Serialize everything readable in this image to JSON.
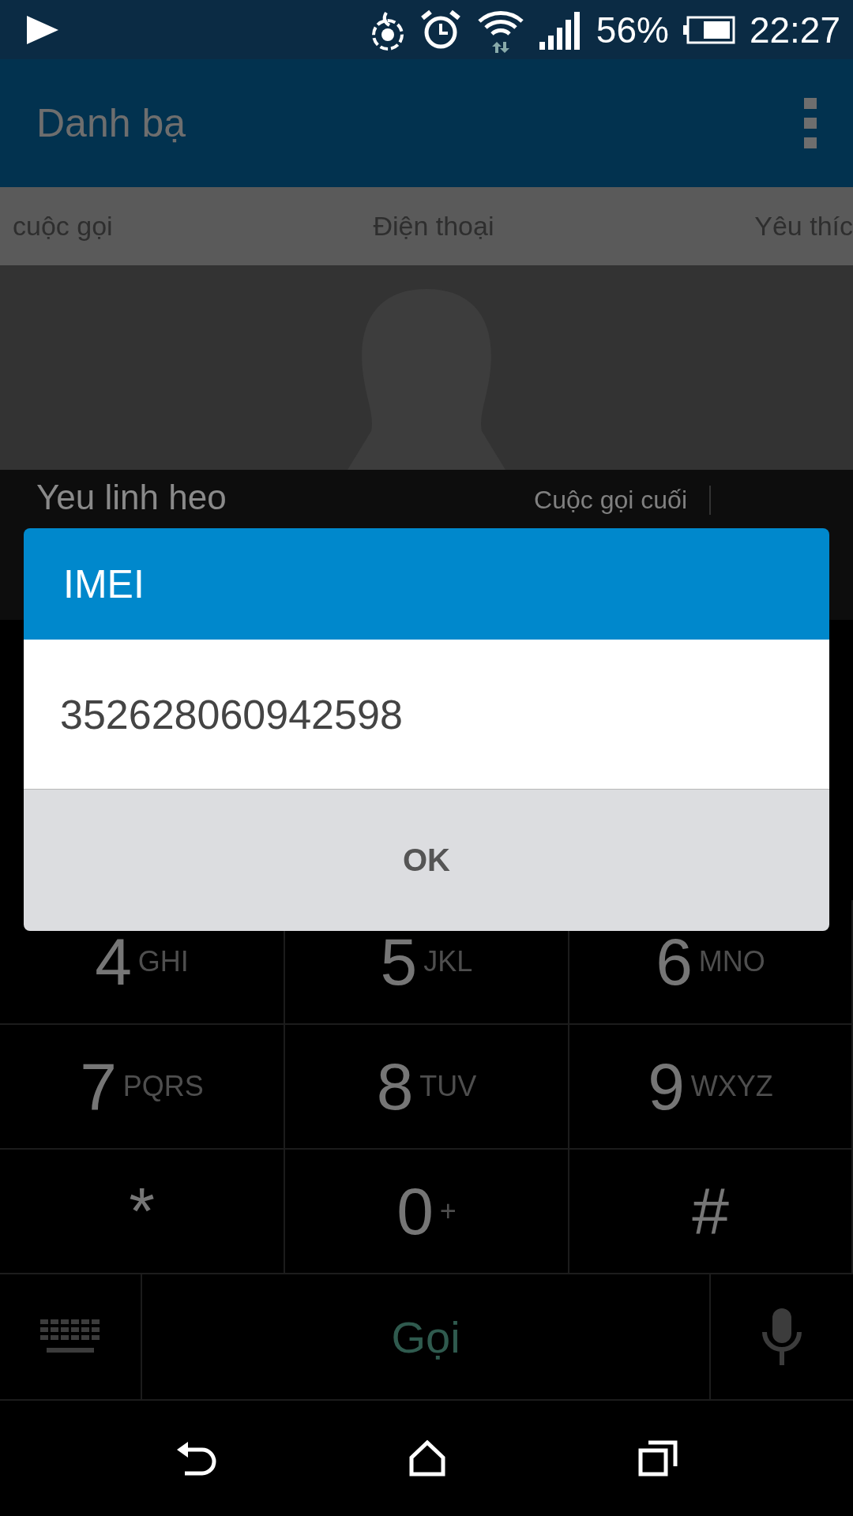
{
  "status_bar": {
    "battery": "56%",
    "time": "22:27"
  },
  "app_bar": {
    "title": "Danh bạ"
  },
  "tabs": [
    {
      "label": "cuộc gọi"
    },
    {
      "label": "Điện thoại"
    },
    {
      "label": "Yêu thíc"
    }
  ],
  "contact": {
    "name": "Yeu linh heo",
    "last_call_label": "Cuộc gọi cuối"
  },
  "dialog": {
    "title": "IMEI",
    "message": "352628060942598",
    "button": "OK"
  },
  "keypad": [
    {
      "digit": "4",
      "letters": "GHI"
    },
    {
      "digit": "5",
      "letters": "JKL"
    },
    {
      "digit": "6",
      "letters": "MNO"
    },
    {
      "digit": "7",
      "letters": "PQRS"
    },
    {
      "digit": "8",
      "letters": "TUV"
    },
    {
      "digit": "9",
      "letters": "WXYZ"
    },
    {
      "digit": "*"
    },
    {
      "digit": "0",
      "letters": "+"
    },
    {
      "digit": "#"
    }
  ],
  "call_bar": {
    "call_label": "Gọi"
  }
}
